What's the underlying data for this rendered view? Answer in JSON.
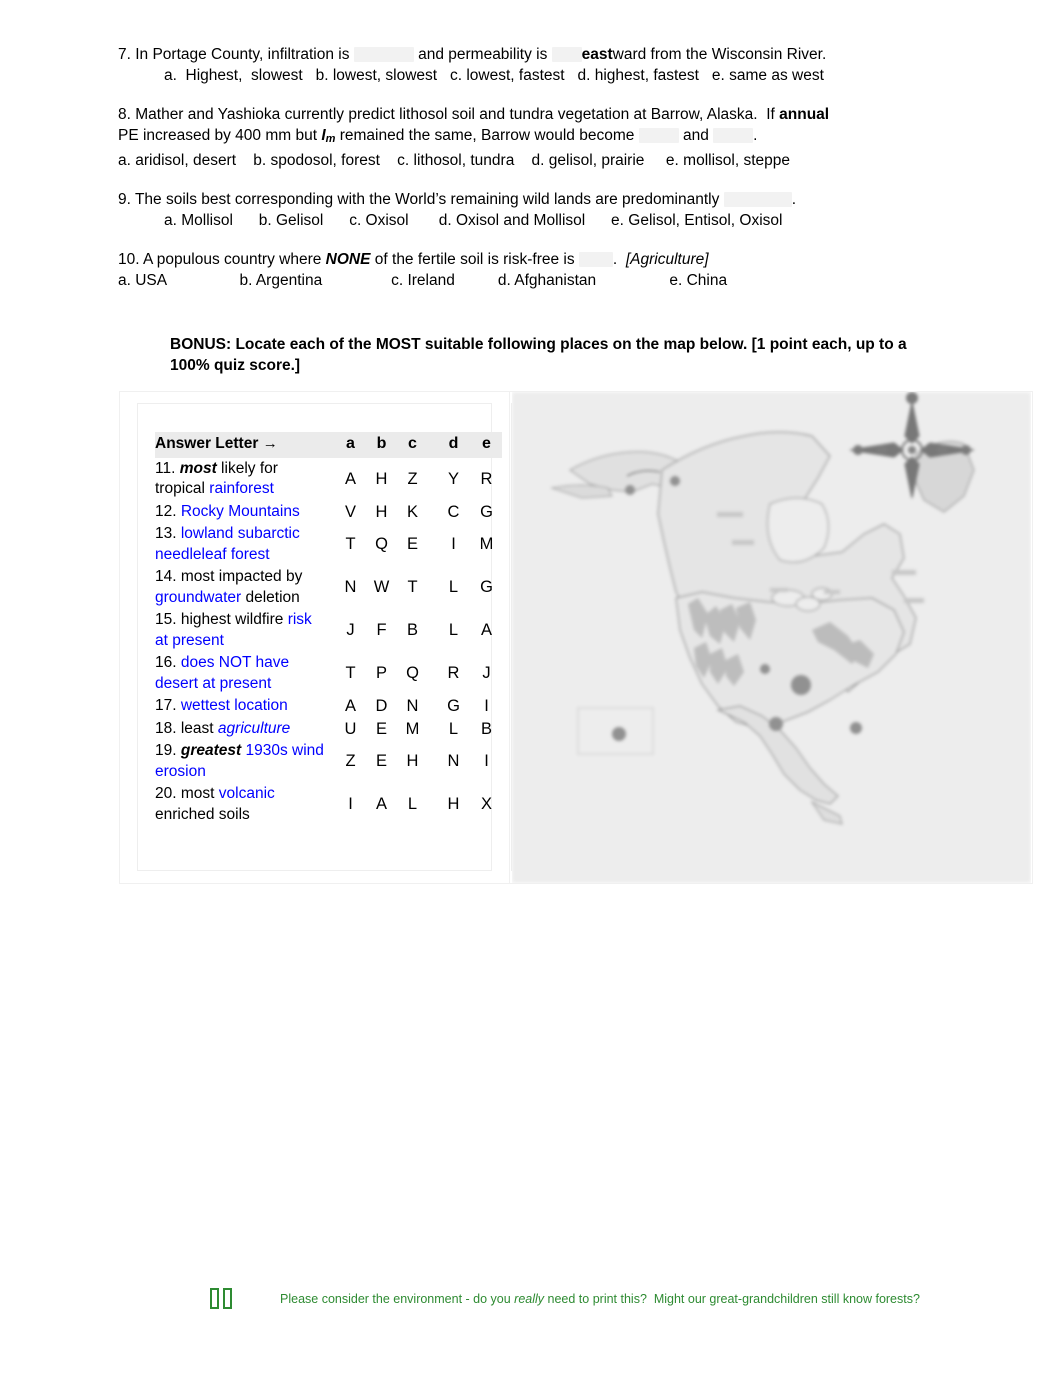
{
  "questions": [
    {
      "id": "q7",
      "stem_pre": "7. In Portage County, infiltration is ",
      "stem_mid": " and permeability is ",
      "stem_bold": "east",
      "stem_post": "ward from the Wisconsin River.",
      "options": "a.  Highest,  slowest   b. lowest, slowest   c. lowest, fastest   d. highest, fastest   e. same as west"
    },
    {
      "id": "q8",
      "line1_a": "8. Mather and Yashioka currently predict lithosol soil and tundra vegetation at Barrow, Alaska.  If ",
      "line1_bold": "annual",
      "line2_a": "PE increased by 400 mm but ",
      "line2_italic_I": "I",
      "line2_sub": "m",
      "line2_b": " remained the same, Barrow would become ",
      "line2_and": " and ",
      "line2_end": ".",
      "options": "a. aridisol, desert    b. spodosol, forest    c. lithosol, tundra    d. gelisol, prairie     e. mollisol, steppe"
    },
    {
      "id": "q9",
      "stem_pre": "9. The soils best corresponding with the World’s remaining wild lands are predominantly ",
      "stem_post": ".",
      "options": "a. Mollisol      b. Gelisol      c. Oxisol       d. Oxisol and Mollisol      e. Gelisol, Entisol, Oxisol"
    },
    {
      "id": "q10",
      "stem_pre": "10. A populous country where ",
      "stem_bold": "NONE",
      "stem_mid": " of the fertile soil is risk-free is ",
      "stem_post": ".  ",
      "stem_tag": "[Agriculture]",
      "options": "a. USA                 b. Argentina                c. Ireland          d. Afghanistan                 e. China"
    }
  ],
  "bonus": {
    "line1": "BONUS:  Locate each of the MOST suitable following places on the map below.  [1 point each, up to a",
    "line2": "100% quiz score.]"
  },
  "answer_table": {
    "header_label": "Answer Letter",
    "header_arrow": "→",
    "columns": [
      "a",
      "b",
      "c",
      "d",
      "e"
    ],
    "rows": [
      {
        "num": "11. ",
        "parts": [
          {
            "t": "most",
            "s": "bolditalic"
          },
          {
            "t": " likely for tropical ",
            "s": "plain"
          },
          {
            "t": "rainforest",
            "s": "blue"
          }
        ],
        "letters": [
          "A",
          "H",
          "Z",
          "Y",
          "R"
        ]
      },
      {
        "num": "12. ",
        "parts": [
          {
            "t": "Rocky Mountains",
            "s": "blue"
          }
        ],
        "letters": [
          "V",
          "H",
          "K",
          "C",
          "G"
        ]
      },
      {
        "num": "13. ",
        "parts": [
          {
            "t": "lowland subarctic needleleaf forest",
            "s": "blue"
          }
        ],
        "letters": [
          "T",
          "Q",
          "E",
          "I",
          "M"
        ]
      },
      {
        "num": "14. ",
        "parts": [
          {
            "t": "most impacted by ",
            "s": "plain"
          },
          {
            "t": "groundwater",
            "s": "blue"
          },
          {
            "t": " deletion",
            "s": "plain"
          }
        ],
        "letters": [
          "N",
          "W",
          "T",
          "L",
          "G"
        ]
      },
      {
        "num": "15. ",
        "parts": [
          {
            "t": "highest wildfire ",
            "s": "plain"
          },
          {
            "t": "risk at present",
            "s": "blue"
          }
        ],
        "letters": [
          "J",
          "F",
          "B",
          "L",
          "A"
        ]
      },
      {
        "num": "16. ",
        "parts": [
          {
            "t": "does NOT have desert at present",
            "s": "blue"
          }
        ],
        "letters": [
          "T",
          "P",
          "Q",
          "R",
          "J"
        ]
      },
      {
        "num": "17. ",
        "parts": [
          {
            "t": "wettest location",
            "s": "blue"
          }
        ],
        "letters": [
          "A",
          "D",
          "N",
          "G",
          "I"
        ]
      },
      {
        "num": "18. ",
        "parts": [
          {
            "t": "least ",
            "s": "plain"
          },
          {
            "t": "agriculture",
            "s": "blueitalic"
          }
        ],
        "letters": [
          "U",
          "E",
          "M",
          "L",
          "B"
        ]
      },
      {
        "num": "19. ",
        "parts": [
          {
            "t": "greatest",
            "s": "bolditalic"
          },
          {
            "t": " ",
            "s": "plain"
          },
          {
            "t": "1930s wind erosion",
            "s": "blue"
          }
        ],
        "letters": [
          "Z",
          "E",
          "H",
          "N",
          "I"
        ]
      },
      {
        "num": "20. ",
        "parts": [
          {
            "t": "most ",
            "s": "plain"
          },
          {
            "t": "volcanic",
            "s": "blue"
          },
          {
            "t": " enriched soils",
            "s": "plain"
          }
        ],
        "letters": [
          "I",
          "A",
          "L",
          "H",
          "X"
        ]
      }
    ]
  },
  "map": {
    "description": "blurred grayscale North America physical map with compass rose"
  },
  "footer": {
    "text_a": "Please consider the environment - do you ",
    "text_italic": "really",
    "text_b": " need to print this?  Might our great-grandchildren still know forests?",
    "color": "#2e8b32"
  },
  "colors": {
    "blue": "#0000ff",
    "green": "#2e8b32",
    "blank": "#f2f2f2",
    "header_shade": "#ebebeb"
  }
}
